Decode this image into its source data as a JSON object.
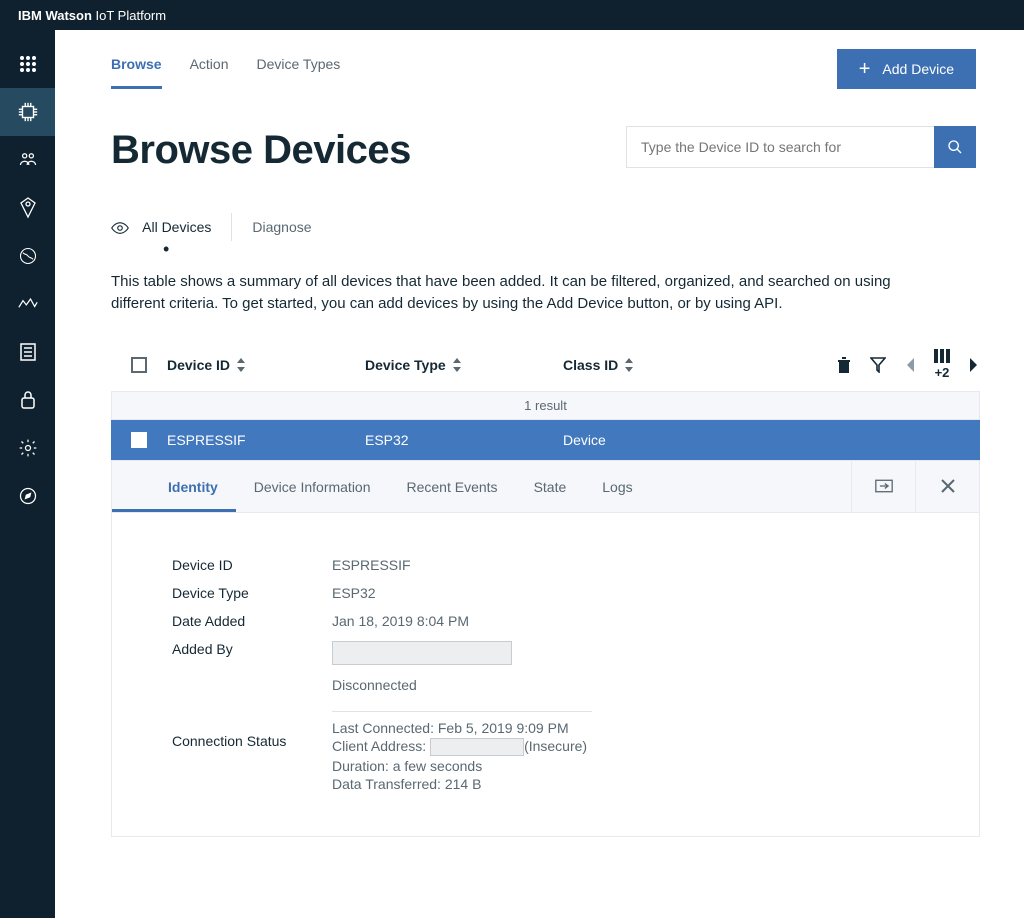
{
  "app_title_prefix": "IBM Watson",
  "app_title_suffix": " IoT Platform",
  "tabs": [
    "Browse",
    "Action",
    "Device Types"
  ],
  "active_tab": 0,
  "add_button_label": "Add Device",
  "page_title": "Browse Devices",
  "search_placeholder": "Type the Device ID to search for",
  "subtabs": {
    "all": "All Devices",
    "diagnose": "Diagnose"
  },
  "description": "This table shows a summary of all devices that have been added. It can be filtered, organized, and searched on using different criteria. To get started, you can add devices by using the Add Device button, or by using API.",
  "columns": {
    "device_id": "Device ID",
    "device_type": "Device Type",
    "class_id": "Class ID"
  },
  "extra_columns_badge": "+2",
  "result_count": "1 result",
  "row": {
    "device_id": "ESPRESSIF",
    "device_type": "ESP32",
    "class_id": "Device"
  },
  "detail_tabs": [
    "Identity",
    "Device Information",
    "Recent Events",
    "State",
    "Logs"
  ],
  "active_detail_tab": 0,
  "identity": {
    "labels": {
      "device_id": "Device ID",
      "device_type": "Device Type",
      "date_added": "Date Added",
      "added_by": "Added By",
      "connection_status": "Connection Status"
    },
    "values": {
      "device_id": "ESPRESSIF",
      "device_type": "ESP32",
      "date_added": "Jan 18, 2019 8:04 PM",
      "status": "Disconnected",
      "last_connected_label": "Last Connected: ",
      "last_connected_value": "Feb 5, 2019 9:09 PM",
      "client_address_label": "Client Address: ",
      "client_address_suffix": "(Insecure)",
      "duration_label": "Duration: ",
      "duration_value": "a few seconds",
      "data_label": "Data Transferred: ",
      "data_value": "214 B"
    }
  },
  "sidebar_items": [
    "apps",
    "devices",
    "members",
    "access",
    "rules",
    "analytics",
    "logs",
    "security",
    "settings",
    "explore"
  ]
}
